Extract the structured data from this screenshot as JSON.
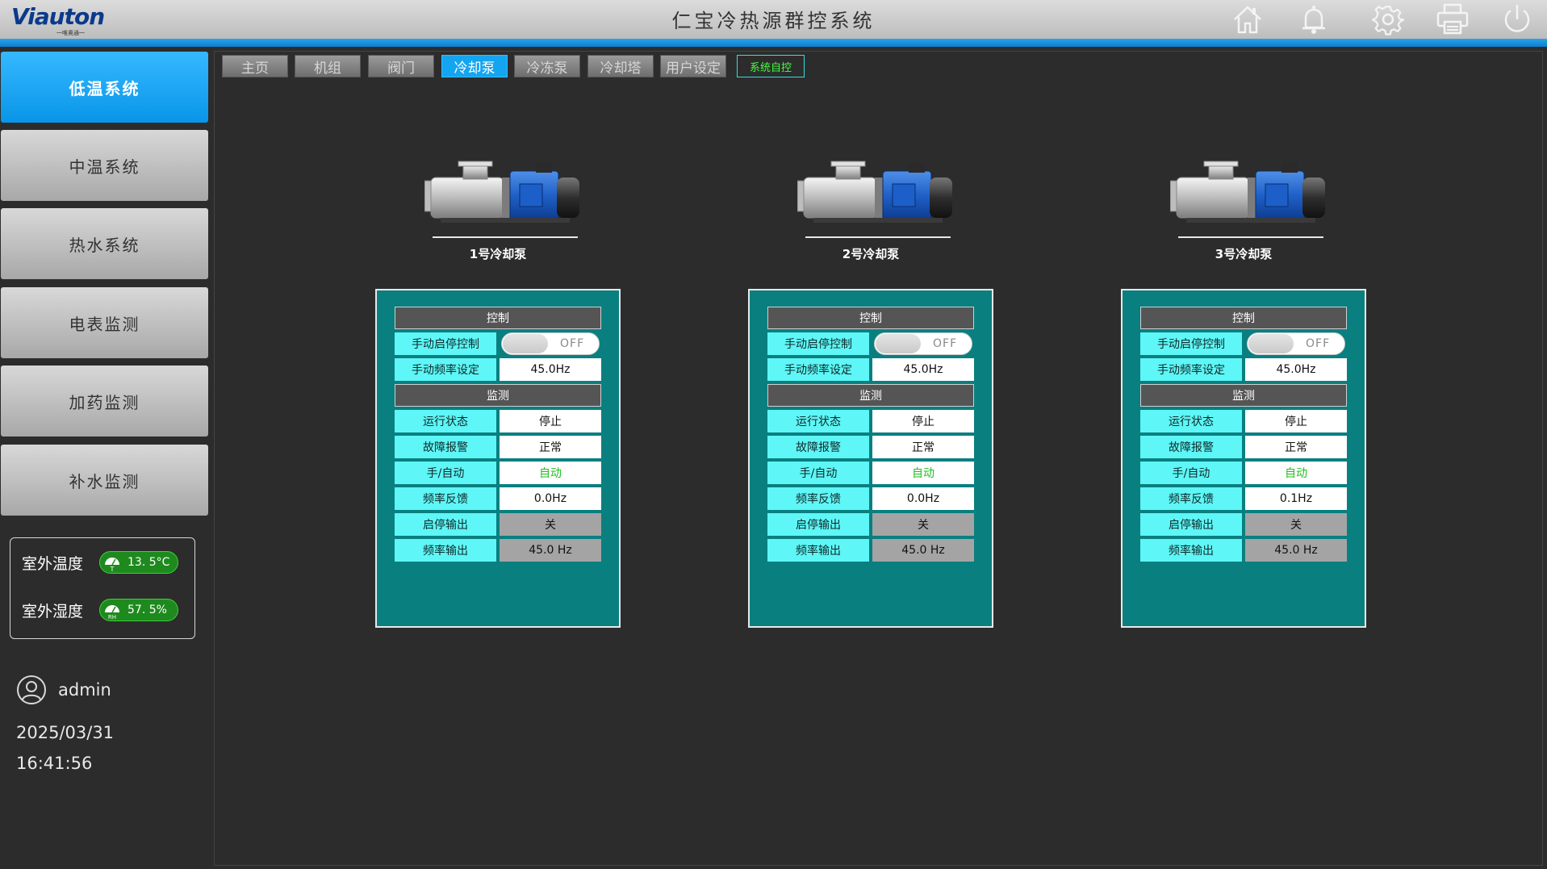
{
  "header": {
    "logo_text": "Viauton",
    "logo_sub": "一唯奥通一",
    "title": "仁宝冷热源群控系统",
    "icons": [
      "home-icon",
      "bell-icon",
      "gear-icon",
      "printer-icon",
      "power-icon"
    ]
  },
  "sidebar": {
    "items": [
      {
        "label": "低温系统",
        "active": true
      },
      {
        "label": "中温系统"
      },
      {
        "label": "热水系统"
      },
      {
        "label": "电表监测"
      },
      {
        "label": "加药监测"
      },
      {
        "label": "补水监测"
      }
    ],
    "env": {
      "temp_label": "室外温度",
      "temp_value": "13. 5°C",
      "temp_gauge": "T",
      "hum_label": "室外湿度",
      "hum_value": "57. 5%",
      "hum_gauge": "RH"
    },
    "user": "admin",
    "date": "2025/03/31",
    "time": "16:41:56"
  },
  "tabs": [
    "主页",
    "机组",
    "阀门",
    "冷却泵",
    "冷冻泵",
    "冷却塔",
    "用户设定"
  ],
  "active_tab": "冷却泵",
  "auto_tag": "系统自控",
  "pumps": [
    {
      "name": "1号冷却泵",
      "control_title": "控制",
      "manual_switch_label": "手动启停控制",
      "manual_switch_state": "OFF",
      "freq_set_label": "手动频率设定",
      "freq_set_value": "45.0Hz",
      "monitor_title": "监测",
      "rows": [
        {
          "label": "运行状态",
          "value": "停止"
        },
        {
          "label": "故障报警",
          "value": "正常"
        },
        {
          "label": "手/自动",
          "value": "自动"
        },
        {
          "label": "频率反馈",
          "value": "0.0Hz"
        },
        {
          "label": "启停输出",
          "value": "关"
        },
        {
          "label": "频率输出",
          "value": "45.0 Hz"
        }
      ]
    },
    {
      "name": "2号冷却泵",
      "control_title": "控制",
      "manual_switch_label": "手动启停控制",
      "manual_switch_state": "OFF",
      "freq_set_label": "手动频率设定",
      "freq_set_value": "45.0Hz",
      "monitor_title": "监测",
      "rows": [
        {
          "label": "运行状态",
          "value": "停止"
        },
        {
          "label": "故障报警",
          "value": "正常"
        },
        {
          "label": "手/自动",
          "value": "自动"
        },
        {
          "label": "频率反馈",
          "value": "0.0Hz"
        },
        {
          "label": "启停输出",
          "value": "关"
        },
        {
          "label": "频率输出",
          "value": "45.0 Hz"
        }
      ]
    },
    {
      "name": "3号冷却泵",
      "control_title": "控制",
      "manual_switch_label": "手动启停控制",
      "manual_switch_state": "OFF",
      "freq_set_label": "手动频率设定",
      "freq_set_value": "45.0Hz",
      "monitor_title": "监测",
      "rows": [
        {
          "label": "运行状态",
          "value": "停止"
        },
        {
          "label": "故障报警",
          "value": "正常"
        },
        {
          "label": "手/自动",
          "value": "自动"
        },
        {
          "label": "频率反馈",
          "value": "0.1Hz"
        },
        {
          "label": "启停输出",
          "value": "关"
        },
        {
          "label": "频率输出",
          "value": "45.0 Hz"
        }
      ]
    }
  ]
}
